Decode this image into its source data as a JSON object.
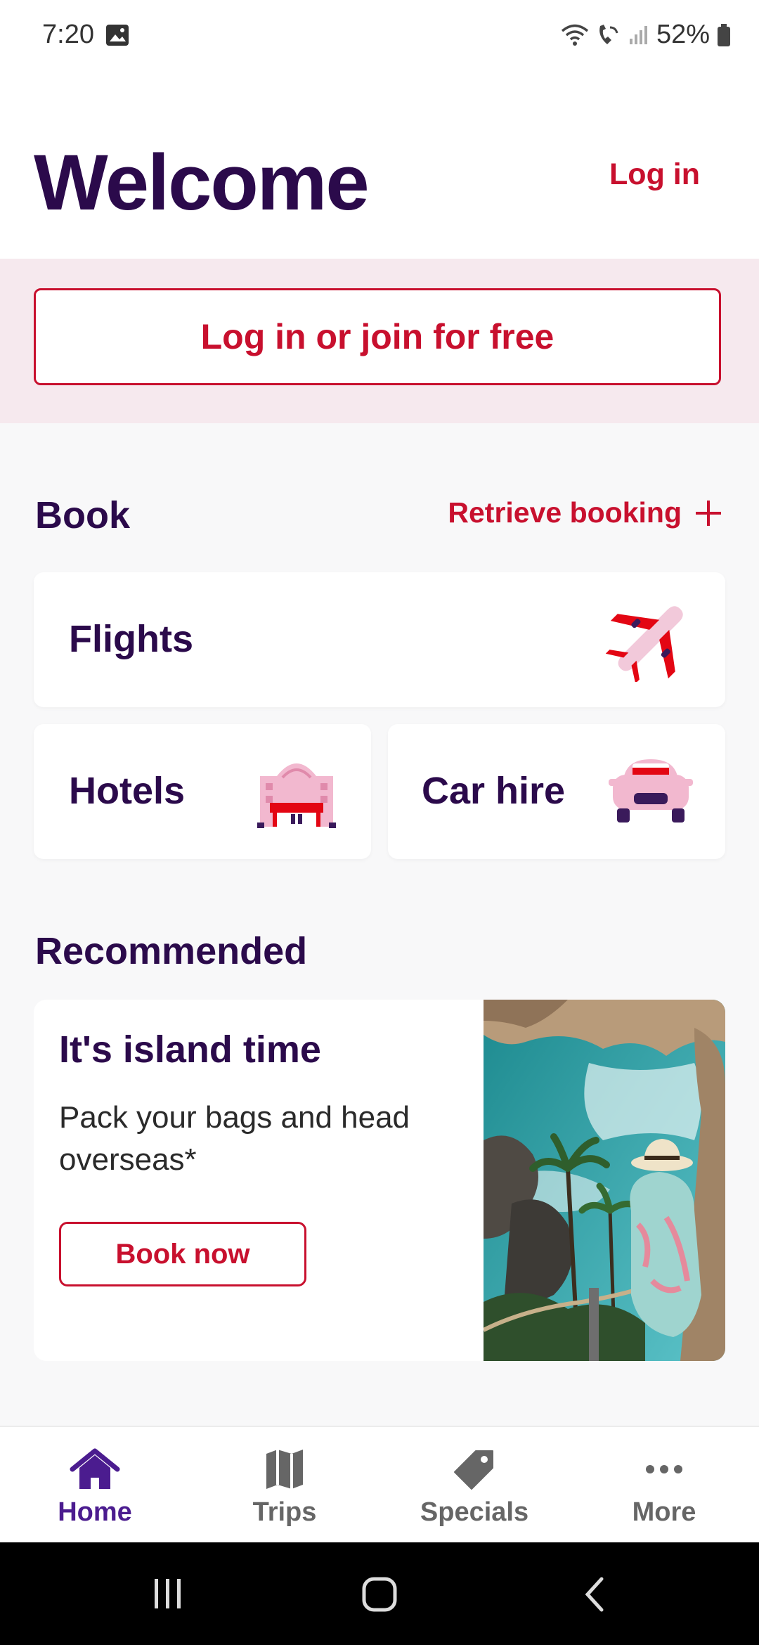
{
  "status": {
    "time": "7:20",
    "battery": "52%"
  },
  "header": {
    "title": "Welcome",
    "login": "Log in"
  },
  "join": {
    "label": "Log in or join for free"
  },
  "book": {
    "title": "Book",
    "retrieve": "Retrieve booking",
    "flights": "Flights",
    "hotels": "Hotels",
    "car_hire": "Car hire"
  },
  "recommended": {
    "title": "Recommended",
    "card_title": "It's island time",
    "card_text": "Pack your bags and head overseas*",
    "cta": "Book now"
  },
  "nav": {
    "home": "Home",
    "trips": "Trips",
    "specials": "Specials",
    "more": "More"
  },
  "colors": {
    "brand_red": "#c8102e",
    "brand_purple": "#2b0a4b",
    "active": "#4b1c8f"
  }
}
